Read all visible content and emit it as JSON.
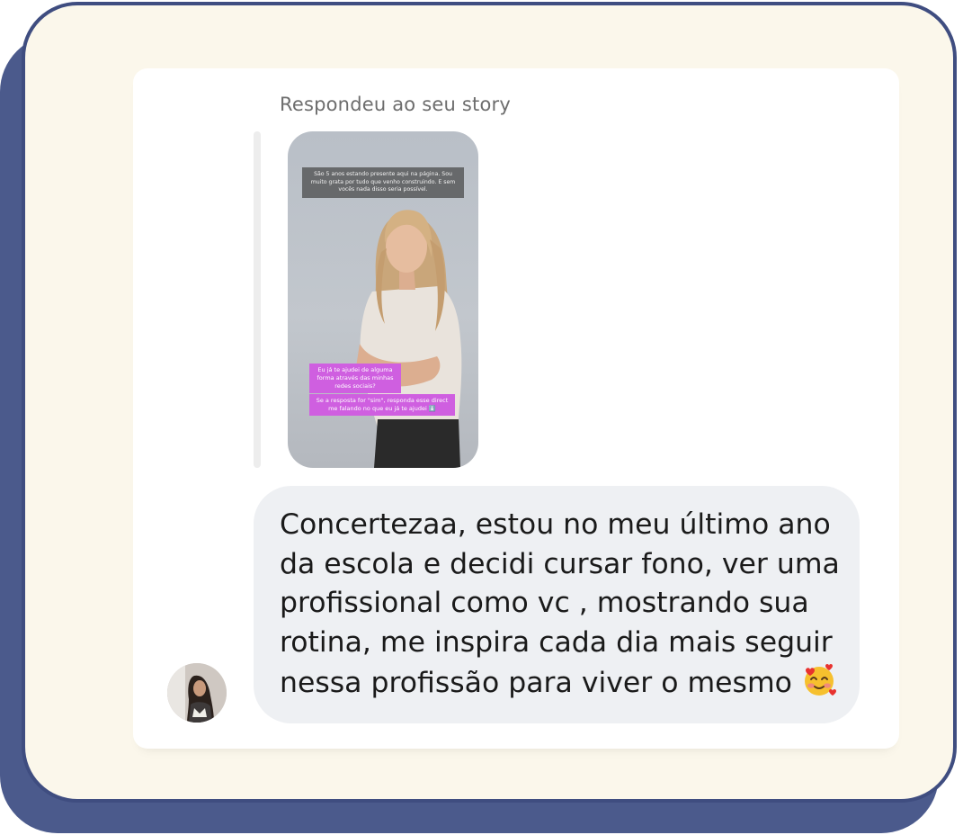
{
  "reply_label": "Respondeu ao seu story",
  "story": {
    "top_caption": "São 5 anos estando presente aqui na página. Sou muito grata por tudo que venho construindo. E sem vocês nada disso seria possível.",
    "box1": "Eu já te ajudei de alguma forma através das minhas redes sociais?",
    "box2": "Se a resposta for \"sim\", responda esse direct me falando no que eu já te ajudei ⬇️"
  },
  "message": {
    "text": "Concertezaa, estou no meu último ano da escola e decidi cursar fono, ver uma profissional como vc , mostrando sua rotina, me inspira cada dia mais seguir nessa profissão para viver o mesmo",
    "emoji_icon": "smiling-face-with-hearts-emoji"
  },
  "colors": {
    "card_background": "#fbf7eb",
    "card_border": "#3f4d80",
    "shadow": "#4b5a8c",
    "bubble": "#eef0f3",
    "story_box": "#cf5fe0"
  }
}
